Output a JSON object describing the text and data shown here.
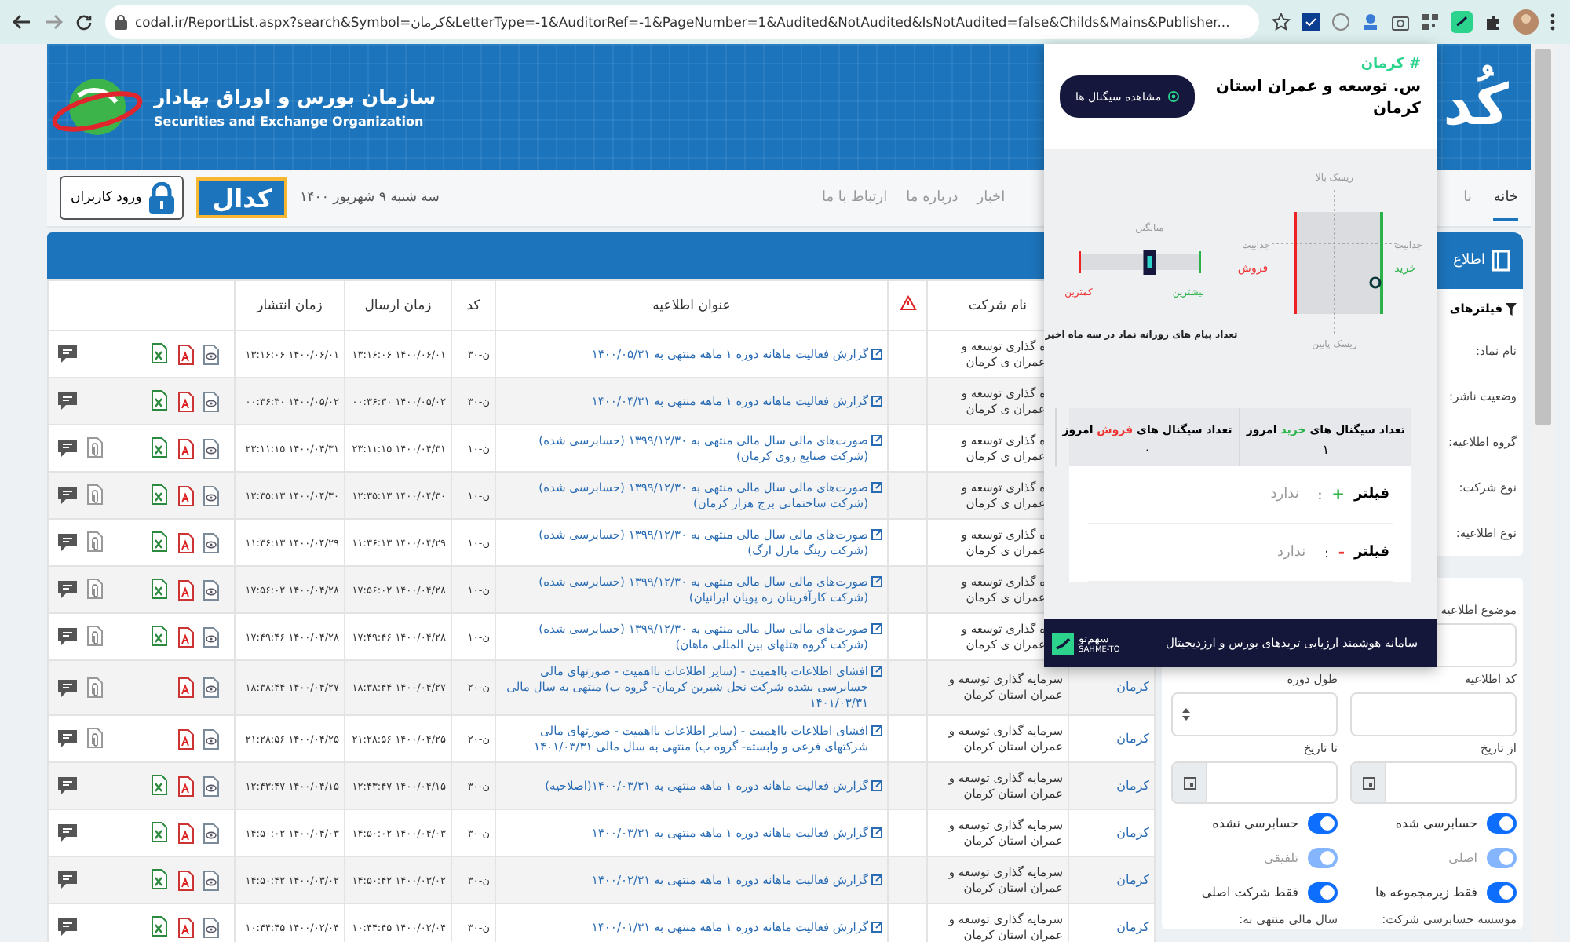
{
  "browser": {
    "url": "codal.ir/ReportList.aspx?search&Symbol=کرمان&LetterType=-1&AuditorRef=-1&PageNumber=1&Audited&NotAudited&IsNotAudited=false&Childs&Mains&Publisher..."
  },
  "header": {
    "org_fa": "سازمان بورس و اوراق بهادار",
    "org_en": "Securities and Exchange Organization",
    "brand": "کُد"
  },
  "nav": {
    "right_items": [
      {
        "label": "خانه",
        "selected": true
      },
      {
        "label": "نا",
        "selected": false
      }
    ],
    "left_items": [
      {
        "label": "اخبار",
        "selected": false
      },
      {
        "label": "درباره ما",
        "selected": false
      },
      {
        "label": "ارتباط با ما",
        "selected": false
      }
    ],
    "date": "سه شنبه ۹ شهریور ۱۴۰۰",
    "logo": "کدال",
    "login": "ورود کاربران"
  },
  "table": {
    "columns": [
      "نام شرکت",
      "عنوان اطلاعیه",
      "کد",
      "زمان ارسال",
      "زمان انتشار"
    ],
    "rows": [
      {
        "covered": true,
        "company": "ه گذاری توسعه و عمران ی کرمان",
        "title": "گزارش فعالیت ماهانه دوره ۱ ماهه منتهی به ۱۴۰۰/۰۵/۳۱",
        "code": "ن-۳۰",
        "sent": "۱۴۰۰/۰۶/۰۱ ۱۳:۱۶:۰۶",
        "published": "۱۴۰۰/۰۶/۰۱ ۱۳:۱۶:۰۶",
        "excel": true,
        "attachment": false
      },
      {
        "covered": true,
        "company": "ه گذاری توسعه و عمران ی کرمان",
        "title": "گزارش فعالیت ماهانه دوره ۱ ماهه منتهی به ۱۴۰۰/۰۴/۳۱",
        "code": "ن-۳۰",
        "sent": "۱۴۰۰/۰۵/۰۲ ۰۰:۳۶:۳۰",
        "published": "۱۴۰۰/۰۵/۰۲ ۰۰:۳۶:۳۰",
        "excel": true,
        "attachment": false
      },
      {
        "covered": true,
        "company": "ه گذاری توسعه و عمران ی کرمان",
        "title": "صورت‌های مالی سال مالی منتهی به ۱۳۹۹/۱۲/۳۰ (حسابرسی شده) (شرکت صنایع روی کرمان)",
        "code": "ن-۱۰",
        "sent": "۱۴۰۰/۰۴/۳۱ ۲۳:۱۱:۱۵",
        "published": "۱۴۰۰/۰۴/۳۱ ۲۳:۱۱:۱۵",
        "excel": true,
        "attachment": true
      },
      {
        "covered": true,
        "company": "ه گذاری توسعه و عمران ی کرمان",
        "title": "صورت‌های مالی سال مالی منتهی به ۱۳۹۹/۱۲/۳۰ (حسابرسی شده) (شرکت ساختمانی برج هزار کرمان)",
        "code": "ن-۱۰",
        "sent": "۱۴۰۰/۰۴/۳۰ ۱۲:۳۵:۱۳",
        "published": "۱۴۰۰/۰۴/۳۰ ۱۲:۳۵:۱۳",
        "excel": true,
        "attachment": true
      },
      {
        "covered": true,
        "company": "ه گذاری توسعه و عمران ی کرمان",
        "title": "صورت‌های مالی سال مالی منتهی به ۱۳۹۹/۱۲/۳۰ (حسابرسی شده) (شرکت رینگ مارل ارگ)",
        "code": "ن-۱۰",
        "sent": "۱۴۰۰/۰۴/۲۹ ۱۱:۳۶:۱۳",
        "published": "۱۴۰۰/۰۴/۲۹ ۱۱:۳۶:۱۳",
        "excel": true,
        "attachment": true
      },
      {
        "covered": true,
        "company": "ه گذاری توسعه و عمران ی کرمان",
        "title": "صورت‌های مالی سال مالی منتهی به ۱۳۹۹/۱۲/۳۰ (حسابرسی شده) (شرکت کارآفرینان ره پویان ایرانیان)",
        "code": "ن-۱۰",
        "sent": "۱۴۰۰/۰۴/۲۸ ۱۷:۵۶:۰۲",
        "published": "۱۴۰۰/۰۴/۲۸ ۱۷:۵۶:۰۲",
        "excel": true,
        "attachment": true
      },
      {
        "covered": true,
        "company": "ه گذاری توسعه و عمران ی کرمان",
        "title": "صورت‌های مالی سال مالی منتهی به ۱۳۹۹/۱۲/۳۰ (حسابرسی شده) (شرکت گروه هتلهای بین المللی ماهان)",
        "code": "ن-۱۰",
        "sent": "۱۴۰۰/۰۴/۲۸ ۱۷:۴۹:۴۶",
        "published": "۱۴۰۰/۰۴/۲۸ ۱۷:۴۹:۴۶",
        "excel": true,
        "attachment": true
      },
      {
        "covered": false,
        "symbol": "کرمان",
        "company": "سرمایه گذاری توسعه و عمران استان کرمان",
        "title": "افشای اطلاعات بااهمیت - (سایر اطلاعات بااهمیت - صورتهای مالی حسابرسی نشده شرکت نخل شیرین کرمان- گروه ب) منتهی به سال مالی ۱۴۰۱/۰۳/۳۱",
        "code": "ن-۲۰",
        "sent": "۱۴۰۰/۰۴/۲۷ ۱۸:۳۸:۴۴",
        "published": "۱۴۰۰/۰۴/۲۷ ۱۸:۳۸:۴۴",
        "excel": false,
        "attachment": true
      },
      {
        "covered": false,
        "symbol": "کرمان",
        "company": "سرمایه گذاری توسعه و عمران استان کرمان",
        "title": "افشای اطلاعات بااهمیت - (سایر اطلاعات بااهمیت - صورتهای مالی شرکتهای فرعی و وابسته- گروه ب) منتهی به سال مالی ۱۴۰۱/۰۳/۳۱",
        "code": "ن-۲۰",
        "sent": "۱۴۰۰/۰۴/۲۵ ۲۱:۲۸:۵۶",
        "published": "۱۴۰۰/۰۴/۲۵ ۲۱:۲۸:۵۶",
        "excel": false,
        "attachment": true
      },
      {
        "covered": false,
        "symbol": "کرمان",
        "company": "سرمایه گذاری توسعه و عمران استان کرمان",
        "title": "گزارش فعالیت ماهانه دوره ۱ ماهه منتهی به ۱۴۰۰/۰۳/۳۱(اصلاحیه)",
        "code": "ن-۳۰",
        "sent": "۱۴۰۰/۰۴/۱۵ ۱۲:۴۳:۴۷",
        "published": "۱۴۰۰/۰۴/۱۵ ۱۲:۴۳:۴۷",
        "excel": true,
        "attachment": false
      },
      {
        "covered": false,
        "symbol": "کرمان",
        "company": "سرمایه گذاری توسعه و عمران استان کرمان",
        "title": "گزارش فعالیت ماهانه دوره ۱ ماهه منتهی به ۱۴۰۰/۰۳/۳۱",
        "code": "ن-۳۰",
        "sent": "۱۴۰۰/۰۴/۰۳ ۱۴:۵۰:۰۲",
        "published": "۱۴۰۰/۰۴/۰۳ ۱۴:۵۰:۰۲",
        "excel": true,
        "attachment": false
      },
      {
        "covered": false,
        "symbol": "کرمان",
        "company": "سرمایه گذاری توسعه و عمران استان کرمان",
        "title": "گزارش فعالیت ماهانه دوره ۱ ماهه منتهی به ۱۴۰۰/۰۲/۳۱",
        "code": "ن-۳۰",
        "sent": "۱۴۰۰/۰۳/۰۲ ۱۴:۵۰:۴۲",
        "published": "۱۴۰۰/۰۳/۰۲ ۱۴:۵۰:۴۲",
        "excel": true,
        "attachment": false
      },
      {
        "covered": false,
        "symbol": "کرمان",
        "company": "سرمایه گذاری توسعه و عمران استان کرمان",
        "title": "گزارش فعالیت ماهانه دوره ۱ ماهه منتهی به ۱۴۰۰/۰۱/۳۱",
        "code": "ن-۳۰",
        "sent": "۱۴۰۰/۰۲/۰۴ ۱۰:۴۴:۴۵",
        "published": "۱۴۰۰/۰۲/۰۴ ۱۰:۴۴:۴۵",
        "excel": true,
        "attachment": false
      }
    ]
  },
  "sidebar": {
    "tab": "اطلاع",
    "filters_title": "فیلترهای",
    "labels": [
      "نام نماد:",
      "وضعیت ناشر:",
      "گروه اطلاعیه:",
      "نوع شرکت:",
      "نوع اطلاعیه:"
    ],
    "subject_label": "موضوع اطلاعیه",
    "code_label": "کد اطلاعیه",
    "period_label": "طول دوره",
    "from_label": "از تاریخ",
    "to_label": "تا تاریخ",
    "toggles": [
      {
        "label": "حسابرسی شده",
        "on": true,
        "disabled": false
      },
      {
        "label": "حسابرسی نشده",
        "on": true,
        "disabled": false
      },
      {
        "label": "اصلی",
        "on": true,
        "disabled": true
      },
      {
        "label": "تلفیقی",
        "on": true,
        "disabled": true
      },
      {
        "label": "فقط زیرمجموعه ها",
        "on": true,
        "disabled": false
      },
      {
        "label": "فقط شرکت اصلی",
        "on": true,
        "disabled": false
      }
    ],
    "auditor_label": "موسسه حسابرسی شرکت:",
    "fiscal_label": "سال مالی منتهی به:"
  },
  "popup": {
    "tag": "# کرمان",
    "title": "س. توسعه و عمران استان کرمان",
    "button": "مشاهده سیگنال ها",
    "signal_chart": {
      "risk_high": "ریسک بالا",
      "risk_low": "ریسک پایین",
      "buy_top": "جذابیت",
      "buy": "خرید",
      "sell_top": "جذابیت",
      "sell": "فروش"
    },
    "message_meter": {
      "average": "میانگین",
      "min": "کمترین",
      "max": "بیشترین",
      "level": 0.58,
      "caption": "تعداد پیام های روزانه نماد در سه ماه اخیر"
    },
    "counts": [
      {
        "kind": "buy",
        "pre": "تعداد سیگنال های",
        "word": "خرید",
        "post": "امروز",
        "value": "۱"
      },
      {
        "kind": "sell",
        "pre": "تعداد سیگنال های",
        "word": "فروش",
        "post": "امروز",
        "value": "۰"
      }
    ],
    "filters": [
      {
        "kind": "plus",
        "label": "فیلتر",
        "sign": "+",
        "sep": ":",
        "value": "ندارد"
      },
      {
        "kind": "minus",
        "label": "فیلتر",
        "sign": "-",
        "sep": ":",
        "value": "ندارد"
      }
    ],
    "footer": {
      "logo_fa": "سهم‌تو",
      "logo_en": "SAHME-TO",
      "text": "سامانه هوشمند ارزیابی تریدهای بورس و ارزدیجیتال"
    }
  }
}
